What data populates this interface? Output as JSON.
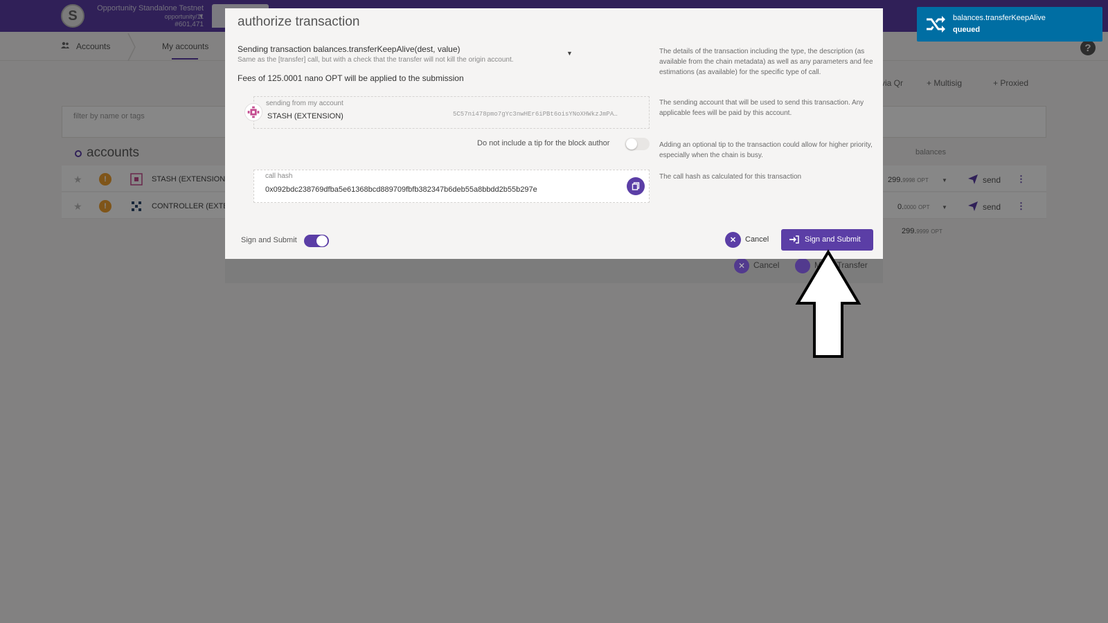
{
  "chain": {
    "logo_letter": "S",
    "name": "Opportunity Standalone Testnet",
    "spec": "opportunity/11",
    "block": "#601,471"
  },
  "subnav": {
    "accounts_label": "Accounts",
    "my_accounts_label": "My accounts"
  },
  "actions": {
    "via_qr": "via Qr",
    "multisig": "+ Multisig",
    "proxied": "+ Proxied"
  },
  "filter": {
    "placeholder": "filter by name or tags"
  },
  "accounts_section": {
    "heading": "accounts",
    "balances_heading": "balances",
    "rows": [
      {
        "name": "STASH (EXTENSION)",
        "balance_main": "299.",
        "balance_frac": "9998",
        "unit": "OPT",
        "send_label": "send"
      },
      {
        "name": "CONTROLLER (EXTENSION)",
        "balance_main": "0.",
        "balance_frac": "0000",
        "unit": "OPT",
        "send_label": "send"
      }
    ],
    "total_main": "299.",
    "total_frac": "9999",
    "total_unit": "OPT"
  },
  "under_modal": {
    "cancel_label": "Cancel",
    "transfer_label": "Make Transfer"
  },
  "modal": {
    "title": "authorize transaction",
    "method": "Sending transaction balances.transferKeepAlive(dest, value)",
    "doc": "Same as the [transfer] call, but with a check that the transfer will not kill the origin account.",
    "fees": "Fees of 125.0001 nano OPT will be applied to the submission",
    "help_tx": "The details of the transaction including the type, the description (as available from the chain metadata) as well as any parameters and fee estimations (as available) for the specific type of call.",
    "help_account": "The sending account that will be used to send this transaction. Any applicable fees will be paid by this account.",
    "help_tip": "Adding an optional tip to the transaction could allow for higher priority, especially when the chain is busy.",
    "help_hash": "The call hash as calculated for this transaction",
    "account_label": "sending from my account",
    "account_name": "STASH (EXTENSION)",
    "account_address": "5C57ni478pmo7gYc3nwHEr6iPBt6oisYNoXHWkzJmPA…",
    "tip_label": "Do not include a tip for the block author",
    "tip_enabled": false,
    "hash_label": "call hash",
    "hash_value": "0x092bdc238769dfba5e61368bcd889709fbfb382347b6deb55a8bbdd2b55b297e",
    "sign_label": "Sign and Submit",
    "sign_enabled": true,
    "cancel_label": "Cancel",
    "submit_label": "Sign and Submit"
  },
  "toast": {
    "method": "balances.transferKeepAlive",
    "status": "queued",
    "color": "#006ea3"
  },
  "colors": {
    "accent": "#5b3ea6",
    "warning": "#f0a030"
  },
  "icons": {
    "toast": "shuffle-icon",
    "submit": "sign-in-icon",
    "copy": "copy-icon",
    "cancel": "close-icon",
    "send": "paper-plane-icon"
  }
}
